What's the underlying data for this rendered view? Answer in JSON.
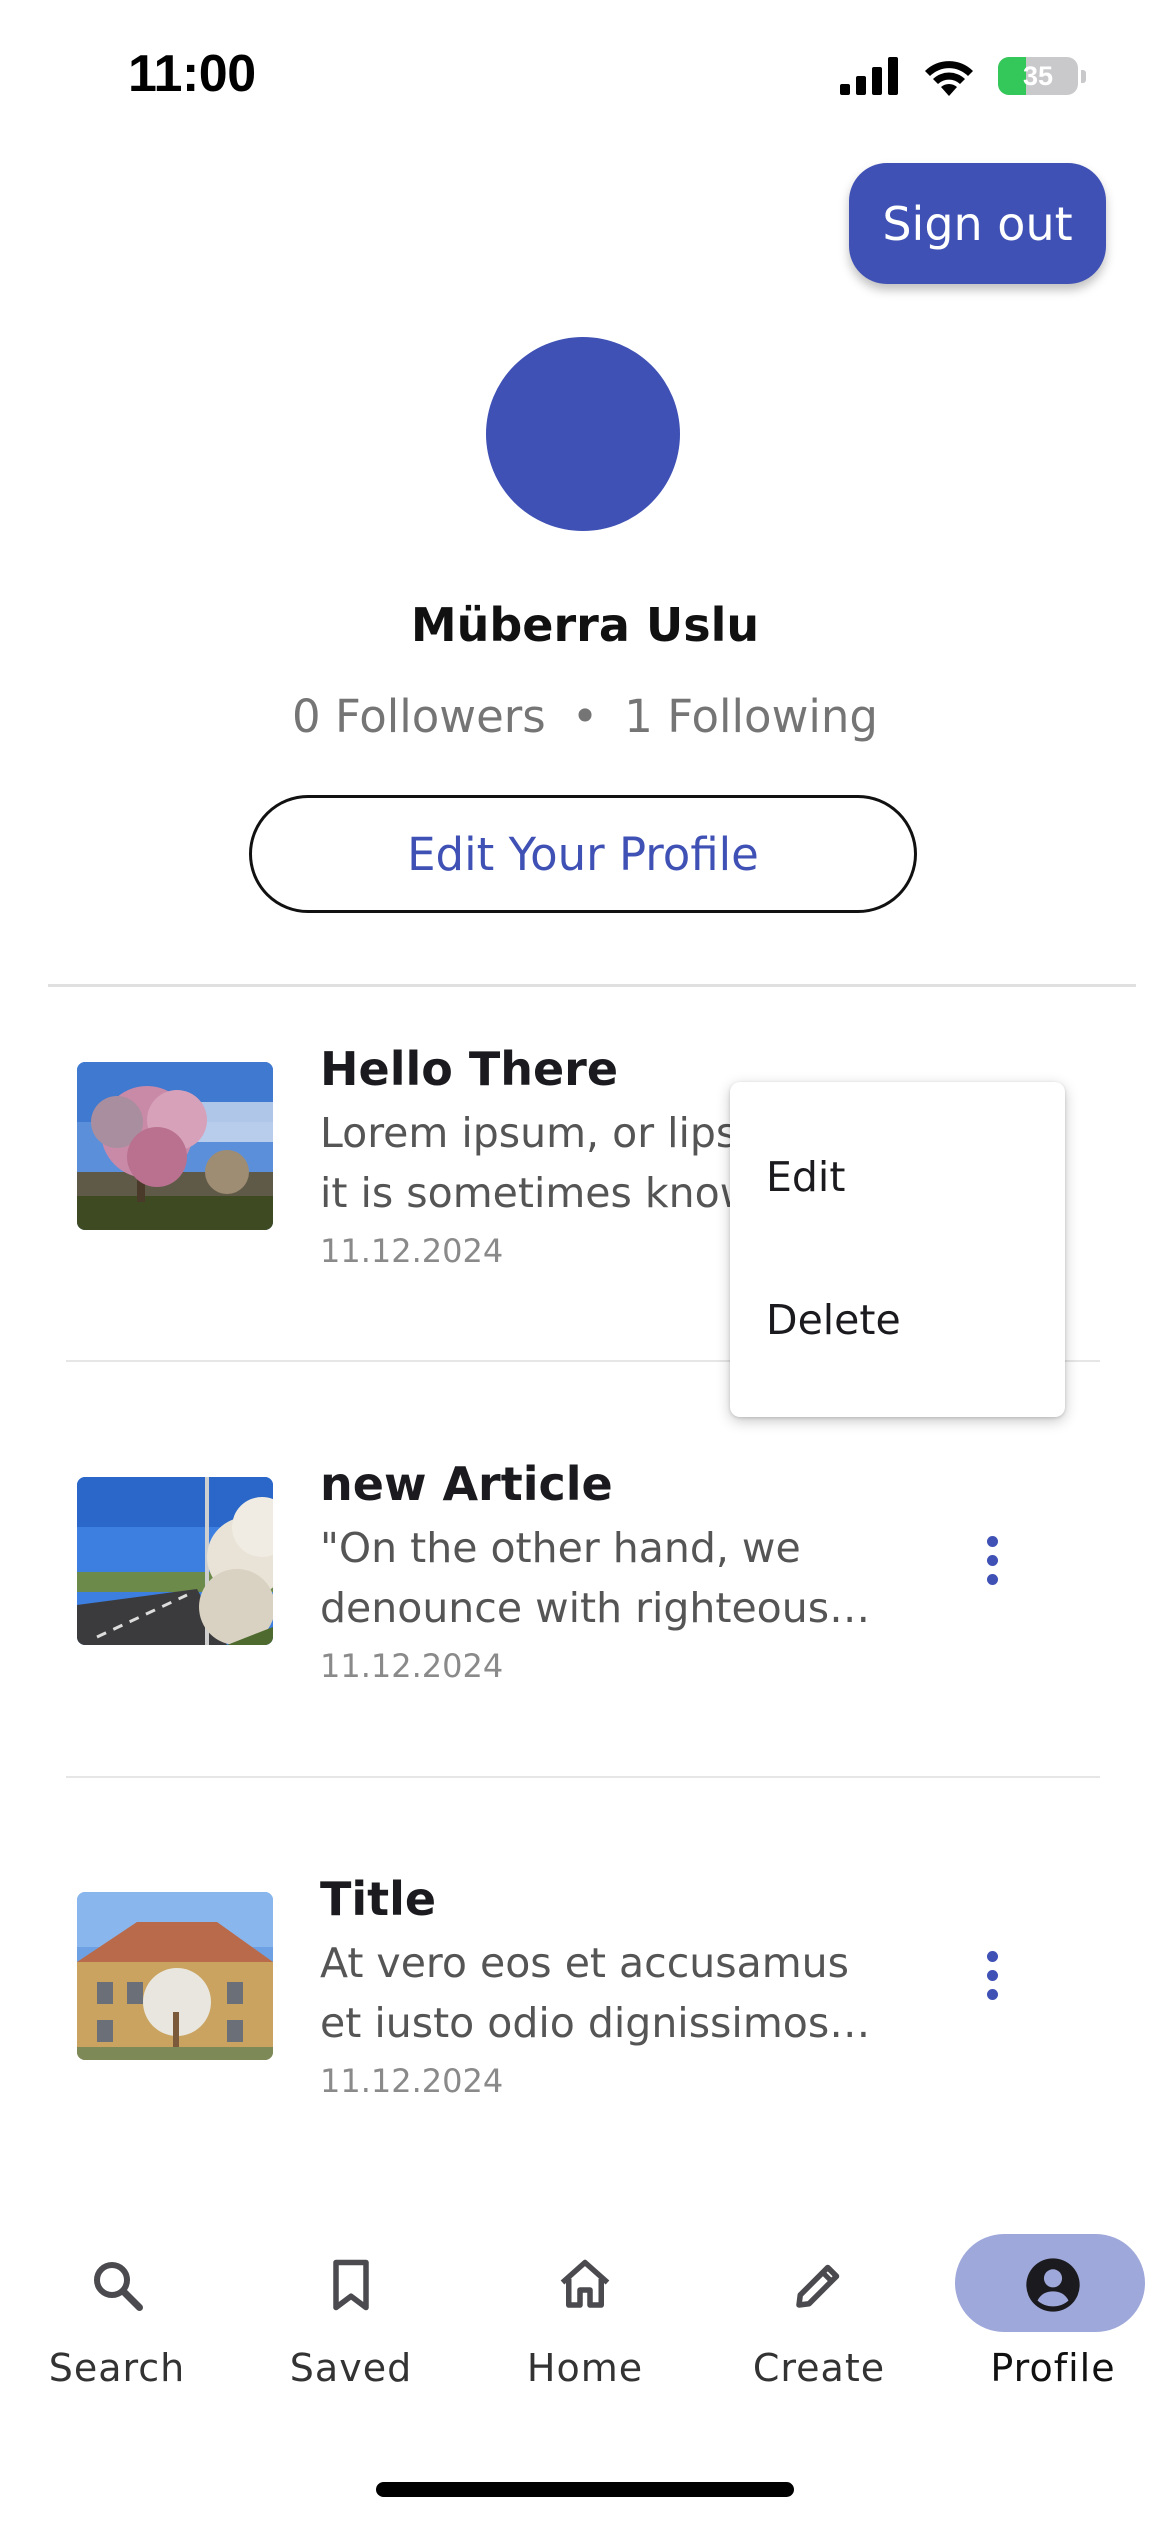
{
  "status_bar": {
    "time": "11:00",
    "battery": "35",
    "battery_level": 0.35
  },
  "header": {
    "sign_out_label": "Sign out"
  },
  "profile": {
    "name": "Müberra Uslu",
    "followers": "0 Followers",
    "separator": "•",
    "following": "1 Following",
    "edit_button_label": "Edit Your Profile"
  },
  "articles": [
    {
      "title": "Hello There",
      "snippet_line1": "Lorem ipsum, or lipsum as",
      "snippet_line2": "it is sometimes known, is",
      "date": "11.12.2024"
    },
    {
      "title": "new Article",
      "snippet_line1": "\"On the other hand, we",
      "snippet_line2": "denounce with righteous …",
      "date": "11.12.2024"
    },
    {
      "title": "Title",
      "snippet_line1": "At vero eos et accusamus",
      "snippet_line2": "et iusto odio dignissimos…",
      "date": "11.12.2024"
    }
  ],
  "context_menu": {
    "edit_label": "Edit",
    "delete_label": "Delete"
  },
  "bottom_nav": {
    "items": [
      {
        "label": "Search",
        "icon": "search-icon"
      },
      {
        "label": "Saved",
        "icon": "bookmark-icon"
      },
      {
        "label": "Home",
        "icon": "home-icon"
      },
      {
        "label": "Create",
        "icon": "pencil-icon"
      },
      {
        "label": "Profile",
        "icon": "account-circle-icon",
        "active": true
      }
    ]
  },
  "colors": {
    "accent": "#3f51b5",
    "nav_active_pill": "#9fa8da"
  }
}
